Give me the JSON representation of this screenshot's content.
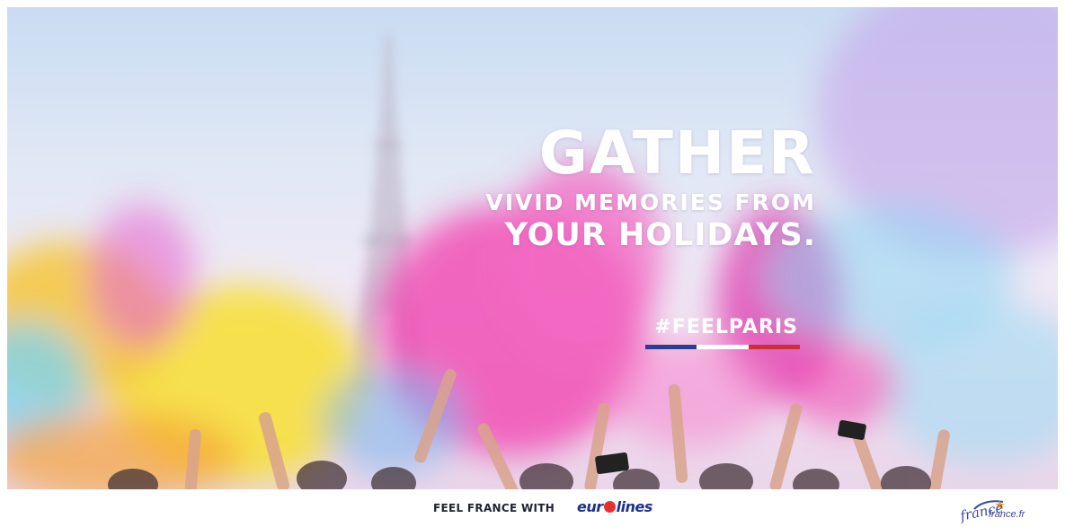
{
  "hero": {
    "headline_line1": "GATHER",
    "headline_line2": "VIVID MEMORIES FROM",
    "headline_line3": "YOUR HOLIDAYS.",
    "hashtag": "#FEELPARIS",
    "flag_colors": [
      "#2b3d8f",
      "#ffffff",
      "#c8303a"
    ]
  },
  "footer": {
    "tagline": "FEEL FRANCE WITH",
    "brand_logo_text": "eurolines",
    "partner_logo_script": "france",
    "partner_logo_domain": "france.fr"
  },
  "colors": {
    "pink": "#f04fb5",
    "yellow": "#f7e03a",
    "cyan": "#7fd3ef",
    "orange": "#f5a43a",
    "purple": "#b78ee0"
  }
}
